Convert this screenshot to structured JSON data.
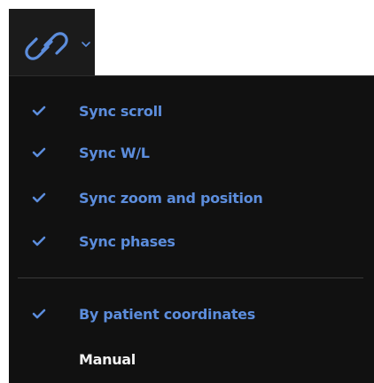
{
  "toolbar": {
    "icon": "link-icon",
    "dropdown_icon": "chevron-down-icon",
    "accent_color": "#5c8ddc"
  },
  "menu": {
    "items": [
      {
        "label": "Sync scroll",
        "checked": true
      },
      {
        "label": "Sync W/L",
        "checked": true
      },
      {
        "label": "Sync zoom and position",
        "checked": true
      },
      {
        "label": "Sync phases",
        "checked": true
      }
    ],
    "modes": [
      {
        "label": "By patient coordinates",
        "checked": true
      },
      {
        "label": "Manual",
        "checked": false
      }
    ]
  }
}
